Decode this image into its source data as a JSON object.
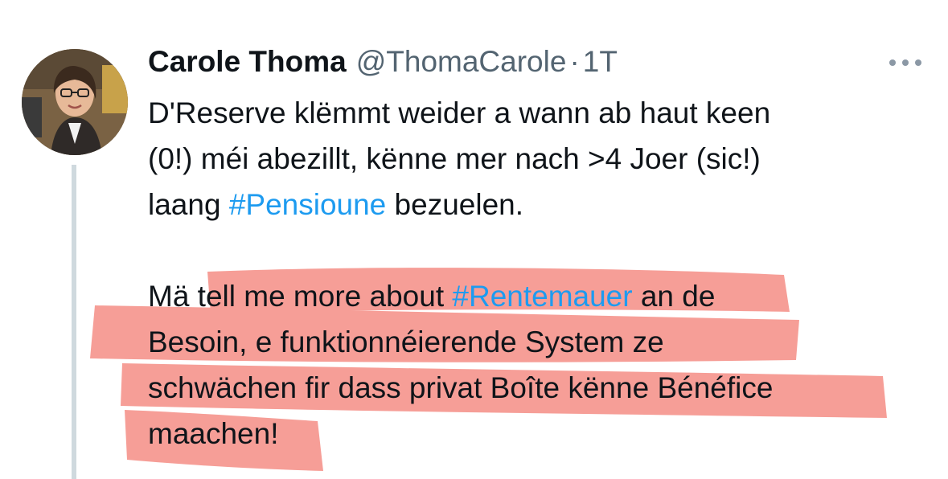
{
  "tweet": {
    "author_name": "Carole Thoma",
    "author_handle": "@ThomaCarole",
    "separator": "·",
    "time_ago": "1T",
    "more_icon": "more-horizontal-icon",
    "paragraph1": {
      "line1": "D'Reserve klëmmt weider a wann ab haut keen",
      "line2": "(0!) méi abezillt, kënne mer nach >4 Joer (sic!)",
      "line3_before": "laang ",
      "hashtag_pensioune": "#Pensioune",
      "line3_after": " bezuelen."
    },
    "paragraph2": {
      "line1_before": "Mä tell me more about ",
      "hashtag_rentemauer": "#Rentemauer",
      "line1_after": " an de",
      "line2": "Besoin, e funktionnéierende System ze",
      "line3": "schwächen fir dass privat Boîte kënne Bénéfice",
      "line4": "maachen!"
    }
  },
  "colors": {
    "text": "#0f1419",
    "secondary": "#536471",
    "hashtag": "#1d9bf0",
    "highlight": "#f4837a",
    "thread_line": "#cfd9de"
  }
}
